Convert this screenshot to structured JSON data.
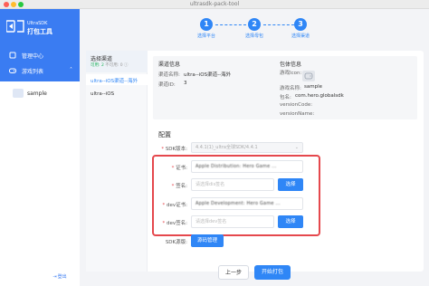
{
  "window": {
    "title": "ultrasdk-pack-tool"
  },
  "brand": {
    "en": "UltraSDK",
    "cn": "打包工具"
  },
  "nav": {
    "items": [
      {
        "label": "管理中心",
        "icon": "home-icon"
      },
      {
        "label": "游戏列表",
        "icon": "gamepad-icon",
        "chevron": "˄"
      }
    ],
    "games": [
      {
        "label": "sample"
      }
    ]
  },
  "logout": {
    "label": "登出"
  },
  "steps": [
    {
      "number": "1",
      "label": "选择平台"
    },
    {
      "number": "2",
      "label": "选择母包"
    },
    {
      "number": "3",
      "label": "选择渠道"
    }
  ],
  "channels": {
    "title": "选择渠道",
    "status_ok": "可用: 2",
    "status_bad": "不可用: 0",
    "items": [
      {
        "label": "ultra--iOS渠道--海外",
        "active": true
      },
      {
        "label": "ultra--iOS",
        "active": false
      }
    ]
  },
  "channel_info": {
    "title": "渠道信息",
    "name_label": "渠道名称:",
    "name_value": "ultra--iOS渠道--海外",
    "id_label": "渠道ID:",
    "id_value": "3"
  },
  "package_info": {
    "title": "包体信息",
    "icon_label": "游戏Icon:",
    "game_name_label": "游戏名称:",
    "game_name_value": "sample",
    "bundle_label": "包名:",
    "bundle_value": "com.hero.globalsdk",
    "version_code_label": "versionCode:",
    "version_name_label": "versionName:"
  },
  "config": {
    "title": "配置",
    "sdk_version_label": "SDK版本:",
    "sdk_version_value": "4.4.1(1)_ultra全球SDK/4.4.1",
    "cert_label": "证书:",
    "cert_value": "Apple Distribution: Hero Game ...",
    "profile_label": "签名:",
    "profile_placeholder": "请选择dis签名",
    "dev_cert_label": "dev证书:",
    "dev_cert_value": "Apple Development: Hero Game ...",
    "dev_profile_label": "dev签名:",
    "dev_profile_placeholder": "请选择dev签名",
    "select_button": "选择",
    "sdk_source_label": "SDK源版:",
    "sdk_source_button": "源码管理"
  },
  "footer": {
    "prev": "上一步",
    "pack": "开始打包"
  },
  "colors": {
    "primary": "#2f86f6",
    "sidebar": "#3a7cf2",
    "highlight": "#e5484d"
  }
}
